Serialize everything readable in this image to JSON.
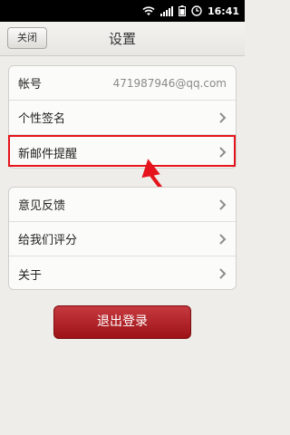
{
  "status_bar": {
    "time": "16:41"
  },
  "title_bar": {
    "close_label": "关闭",
    "title": "设置"
  },
  "group1": [
    {
      "label": "帐号",
      "value": "471987946@qq.com"
    },
    {
      "label": "个性签名"
    },
    {
      "label": "新邮件提醒"
    }
  ],
  "group2": [
    {
      "label": "意见反馈"
    },
    {
      "label": "给我们评分"
    },
    {
      "label": "关于"
    }
  ],
  "logout_label": "退出登录",
  "colors": {
    "highlight": "#e5141c",
    "logout": "#b1242a"
  }
}
